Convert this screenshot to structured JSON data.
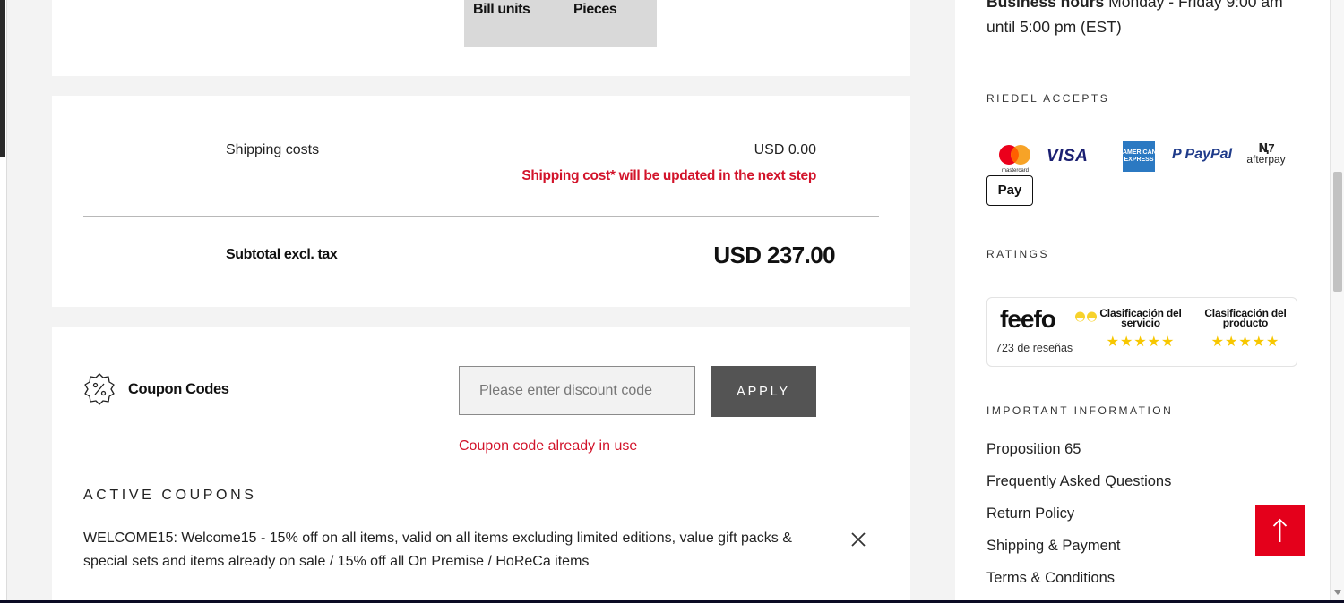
{
  "top_box": {
    "col1": "Bill units",
    "col2": "Pieces"
  },
  "shipping": {
    "label": "Shipping costs",
    "value": "USD 0.00",
    "note": "Shipping cost* will be updated in the next step"
  },
  "subtotal": {
    "label": "Subtotal excl. tax",
    "value": "USD 237.00"
  },
  "coupon": {
    "icon": "percent-badge-icon",
    "title": "Coupon Codes",
    "placeholder": "Please enter discount code",
    "value": "",
    "apply_label": "APPLY",
    "error": "Coupon code already in use",
    "active_title": "ACTIVE COUPONS",
    "active_text": "WELCOME15: Welcome15 - 15% off on all items, valid on all items excluding limited editions, value gift packs & special sets and items already on sale / 15% off all On Premise / HoReCa items",
    "remove_icon": "close-icon"
  },
  "sidebar": {
    "hours_bold": "Business hours",
    "hours_text": " Monday - Friday 9:00 am until 5:00 pm (EST)",
    "accepts_title": "RIEDEL ACCEPTS",
    "payments": {
      "mastercard_text": "mastercard",
      "visa": "VISA",
      "amex": "AMERICAN EXPRESS",
      "paypal_a": "PayPal",
      "afterpay_logo": "Ꞑ7",
      "afterpay": "afterpay",
      "applepay": "Pay"
    },
    "ratings_title": "RATINGS",
    "feefo": {
      "logo": "feefo",
      "count": "723 de reseñas",
      "service_title": "Clasificación del servicio",
      "product_title": "Clasificación del producto",
      "service_stars": "★★★★★",
      "product_stars": "★★★★★",
      "service_rating": 5,
      "product_rating": 5
    },
    "info_title": "IMPORTANT INFORMATION",
    "links": [
      "Proposition 65",
      "Frequently Asked Questions",
      "Return Policy",
      "Shipping & Payment",
      "Terms & Conditions"
    ]
  },
  "scroll_top_icon": "arrow-up-icon",
  "colors": {
    "accent_red": "#e4001b",
    "error_red": "#d2132a",
    "button_grey": "#545454"
  }
}
